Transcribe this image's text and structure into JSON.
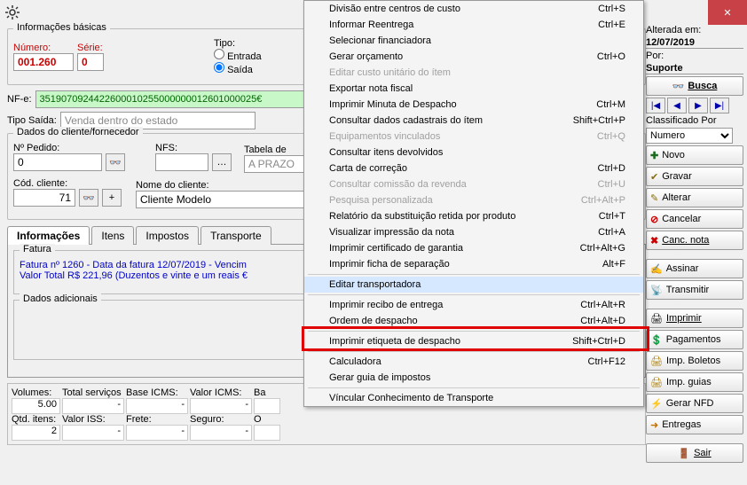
{
  "titlebar": {
    "close_alt": "Close"
  },
  "basics": {
    "legend": "Informações básicas",
    "numero_lbl": "Número:",
    "serie_lbl": "Série:",
    "numero": "001.260",
    "serie": "0",
    "tipo_lbl": "Tipo:",
    "entrada": "Entrada",
    "saida": "Saída"
  },
  "nfe": {
    "lbl": "NF-e:",
    "value": "3519070924422600010255000000012601000025€"
  },
  "tipo_saida": {
    "lbl": "Tipo Saída:",
    "value": "Venda dentro do estado"
  },
  "cliente": {
    "legend": "Dados do cliente/fornecedor",
    "n_pedido_lbl": "Nº Pedido:",
    "n_pedido": "0",
    "nfs_lbl": "NFS:",
    "tabela_lbl": "Tabela de",
    "tabela_val": "A PRAZO",
    "cod_cli_lbl": "Cód. cliente:",
    "cod_cli": "71",
    "nome_cli_lbl": "Nome do cliente:",
    "nome_cli": "Cliente Modelo"
  },
  "tabs": {
    "informacoes": "Informações",
    "itens": "Itens",
    "impostos": "Impostos",
    "transporte": "Transporte"
  },
  "fatura": {
    "legend": "Fatura",
    "l1": "Fatura nº 1260 - Data da fatura 12/07/2019 - Vencim",
    "l2": "Valor Total R$ 221,96 (Duzentos e vinte e um reais €"
  },
  "adicionais": {
    "legend": "Dados adicionais"
  },
  "totals": {
    "volumes_lbl": "Volumes:",
    "volumes": "5.00",
    "qtd_itens_lbl": "Qtd. itens:",
    "qtd_itens": "2",
    "tot_serv_lbl": "Total serviços",
    "base_icms_lbl": "Base ICMS:",
    "valor_icms_lbl": "Valor ICMS:",
    "ba_lbl": "Ba",
    "valor_iss_lbl": "Valor ISS:",
    "frete_lbl": "Frete:",
    "seguro_lbl": "Seguro:",
    "o_lbl": "O",
    "dash": "-"
  },
  "side": {
    "alterada_lbl": "Alterada em:",
    "alterada": "12/07/2019",
    "por_lbl": "Por:",
    "por": "Suporte",
    "busca": "Busca",
    "class_lbl": "Classificado Por",
    "class_val": "Numero",
    "novo": "Novo",
    "gravar": "Gravar",
    "alterar": "Alterar",
    "cancelar": "Cancelar",
    "canc_nota": "Canc. nota",
    "assinar": "Assinar",
    "transmitir": "Transmitir",
    "imprimir": "Imprimir",
    "pagamentos": "Pagamentos",
    "imp_boletos": "Imp. Boletos",
    "imp_guias": "Imp. guias",
    "gerar_nfd": "Gerar NFD",
    "entregas": "Entregas",
    "sair": "Sair"
  },
  "menu": [
    {
      "label": "Divisão entre centros de custo",
      "shortcut": "Ctrl+S",
      "enabled": true
    },
    {
      "label": "Informar Reentrega",
      "shortcut": "Ctrl+E",
      "enabled": true
    },
    {
      "label": "Selecionar financiadora",
      "shortcut": "",
      "enabled": true
    },
    {
      "label": "Gerar orçamento",
      "shortcut": "Ctrl+O",
      "enabled": true
    },
    {
      "label": "Editar custo unitário do ítem",
      "shortcut": "",
      "enabled": false
    },
    {
      "label": "Exportar nota fiscal",
      "shortcut": "",
      "enabled": true
    },
    {
      "label": "Imprimir Minuta de Despacho",
      "shortcut": "Ctrl+M",
      "enabled": true
    },
    {
      "label": "Consultar dados cadastrais do ítem",
      "shortcut": "Shift+Ctrl+P",
      "enabled": true
    },
    {
      "label": "Equipamentos vinculados",
      "shortcut": "Ctrl+Q",
      "enabled": false
    },
    {
      "label": "Consultar itens devolvidos",
      "shortcut": "",
      "enabled": true
    },
    {
      "label": "Carta de correção",
      "shortcut": "Ctrl+D",
      "enabled": true
    },
    {
      "label": "Consultar comissão da revenda",
      "shortcut": "Ctrl+U",
      "enabled": false
    },
    {
      "label": "Pesquisa personalizada",
      "shortcut": "Ctrl+Alt+P",
      "enabled": false
    },
    {
      "label": "Relatório da substituição retida por produto",
      "shortcut": "Ctrl+T",
      "enabled": true
    },
    {
      "label": "Visualizar impressão da nota",
      "shortcut": "Ctrl+A",
      "enabled": true
    },
    {
      "label": "Imprimir certificado de garantia",
      "shortcut": "Ctrl+Alt+G",
      "enabled": true
    },
    {
      "label": "Imprimir ficha de separação",
      "shortcut": "Alt+F",
      "enabled": true
    },
    {
      "sep": true
    },
    {
      "label": "Editar transportadora",
      "shortcut": "",
      "enabled": true,
      "hover": true
    },
    {
      "sep": true
    },
    {
      "label": "Imprimir recibo de entrega",
      "shortcut": "Ctrl+Alt+R",
      "enabled": true
    },
    {
      "label": "Ordem de despacho",
      "shortcut": "Ctrl+Alt+D",
      "enabled": true
    },
    {
      "sep": true
    },
    {
      "label": "Imprimir etiqueta de despacho",
      "shortcut": "Shift+Ctrl+D",
      "enabled": true
    },
    {
      "sep": true
    },
    {
      "label": "Calculadora",
      "shortcut": "Ctrl+F12",
      "enabled": true
    },
    {
      "label": "Gerar guia de impostos",
      "shortcut": "",
      "enabled": true
    },
    {
      "sep": true
    },
    {
      "label": "Víncular Conhecimento de Transporte",
      "shortcut": "",
      "enabled": true
    }
  ]
}
